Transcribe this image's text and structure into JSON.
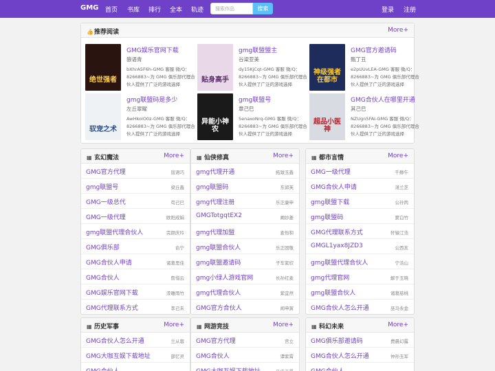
{
  "nav": {
    "brand": "GMG",
    "links": [
      "首页",
      "书库",
      "排行",
      "全本",
      "轨迹"
    ],
    "search_placeholder": "搜索作品",
    "search_button": "搜索",
    "login": "登录",
    "register": "注册"
  },
  "featured": {
    "title": "推荐阅读",
    "more": "More+",
    "books": [
      {
        "title": "GMG娱乐官网下载",
        "author": "狼语青",
        "desc": "bXhrA5F6h-GMG 客服 微/Q：8266883~为 GMG 俱乐部代理合伙人提供了广泛的游戏选择",
        "cover_text": "绝世强者",
        "cover_bg": "#2a1410",
        "cover_fg": "#ffd24d"
      },
      {
        "title": "gmg联盟盟主",
        "author": "谷梁亚美",
        "desc": "dy15KjCqt-GMG 客服 微/Q：8266883~为 GMG 俱乐部代理合伙人提供了广泛的游戏选择",
        "cover_text": "贴身高手",
        "cover_bg": "#e9d8e8",
        "cover_fg": "#5a2a6a"
      },
      {
        "title": "GMG官方邀请码",
        "author": "甄丁丑",
        "desc": "e2pUUvLEA-GMG 客服 微/Q：8266883~为 GMG 俱乐部代理合伙人提供了广泛的游戏选择",
        "cover_text": "神级强者在都市",
        "cover_bg": "#1d2c5a",
        "cover_fg": "#ffcc33"
      },
      {
        "title": "gmg联盟码是多少",
        "author": "左丘翠曜",
        "desc": "AwHkoIO0z-GMG 客服 微/Q：8266883~为 GMG 俱乐部代理合伙人提供了广泛的游戏选择",
        "cover_text": "驭宠之术",
        "cover_bg": "#eef2f4",
        "cover_fg": "#2a4f8c"
      },
      {
        "title": "gmg联盟号",
        "author": "章己巳",
        "desc": "5enaxoNrq-GMG 客服 微/Q：8266883~为 GMG 俱乐部代理合伙人提供了广泛的游戏选择",
        "cover_text": "异能小神农",
        "cover_bg": "#1a1a1a",
        "cover_fg": "#ffffff"
      },
      {
        "title": "GMG合伙人在哪里开通",
        "author": "其己巳",
        "desc": "NZUgn5FAI-GMG 客服 微/Q：8266883~为 GMG 俱乐部代理合伙人提供了广泛的游戏选择",
        "cover_text": "超品小医神",
        "cover_bg": "#d8dce2",
        "cover_fg": "#b3202a"
      }
    ]
  },
  "sections": [
    {
      "title": "玄幻魔法",
      "more": "More+",
      "items": [
        {
          "t": "GMG官方代理",
          "a": "寇语巧"
        },
        {
          "t": "gmg联盟号",
          "a": "梁丘鑫"
        },
        {
          "t": "GMG一级总代",
          "a": "苟己巳"
        },
        {
          "t": "GMG一级代理",
          "a": "欧阳成娟"
        },
        {
          "t": "gmg联盟代理合伙人",
          "a": "完颜庆玲"
        },
        {
          "t": "GMG俱乐部",
          "a": "俞宁"
        },
        {
          "t": "GMG合伙人申请",
          "a": "诸葛思佳"
        },
        {
          "t": "GMG合伙人",
          "a": "詹惜云"
        },
        {
          "t": "GMG娱乐官网下载",
          "a": "漆雕雨竹"
        },
        {
          "t": "GMG代理联系方式",
          "a": "李己未"
        }
      ]
    },
    {
      "title": "仙侠修真",
      "more": "More+",
      "items": [
        {
          "t": "gmg代理开通",
          "a": "拓跋玉鑫"
        },
        {
          "t": "gmg联盟码",
          "a": "东郭芙"
        },
        {
          "t": "gmg代理注册",
          "a": "乐正康申"
        },
        {
          "t": "GMGTotgqtEX2",
          "a": "阚妙菱"
        },
        {
          "t": "gmg代理加盟",
          "a": "麦怡和"
        },
        {
          "t": "gmg联盟合伙人",
          "a": "乐正困敬"
        },
        {
          "t": "gmg联盟邀请码",
          "a": "子车紫欣"
        },
        {
          "t": "gmg小绿人游戏官网",
          "a": "长孙红麦"
        },
        {
          "t": "gmg代理合伙人",
          "a": "紫宜然"
        },
        {
          "t": "GMG官方合伙人",
          "a": "闻申寅"
        }
      ]
    },
    {
      "title": "都市言情",
      "more": "More+",
      "items": [
        {
          "t": "GMG一级代理",
          "a": "千静午"
        },
        {
          "t": "GMG合伙人申请",
          "a": "湛兰芝"
        },
        {
          "t": "gmg联盟下载",
          "a": "公孙丙"
        },
        {
          "t": "gmg联盟码",
          "a": "窦白竹"
        },
        {
          "t": "GMG代理联系方式",
          "a": "轩辕江浩"
        },
        {
          "t": "GMGL1yax8JZD3",
          "a": "公西亥"
        },
        {
          "t": "gmg联盟代理合伙人",
          "a": "宁浩山"
        },
        {
          "t": "gmg代理官网",
          "a": "解于玉晓"
        },
        {
          "t": "gmg联盟合伙人",
          "a": "诸葛慈桃"
        },
        {
          "t": "GMG合伙人怎么开通",
          "a": "巫马永金"
        }
      ]
    },
    {
      "title": "历史军事",
      "more": "More+",
      "items": [
        {
          "t": "GMG合伙人怎么开通",
          "a": "兰从蓉"
        },
        {
          "t": "GMG大咖互娱下载地址",
          "a": "邵忆灵"
        },
        {
          "t": "GMG合伙人...",
          "a": "..."
        }
      ]
    },
    {
      "title": "网游竞技",
      "more": "More+",
      "items": [
        {
          "t": "GMG官方代理",
          "a": "宫立"
        },
        {
          "t": "GMG合伙人",
          "a": "谭紫霄"
        },
        {
          "t": "GMG大咖互娱下载地址",
          "a": "马佳天曼"
        }
      ]
    },
    {
      "title": "科幻未来",
      "more": "More+",
      "items": [
        {
          "t": "GMG俱乐部邀请码",
          "a": "费晨幻露"
        },
        {
          "t": "GMG合伙人怎么开通",
          "a": "仲孙玉军"
        },
        {
          "t": "GMG合伙人...",
          "a": "..."
        }
      ]
    }
  ]
}
